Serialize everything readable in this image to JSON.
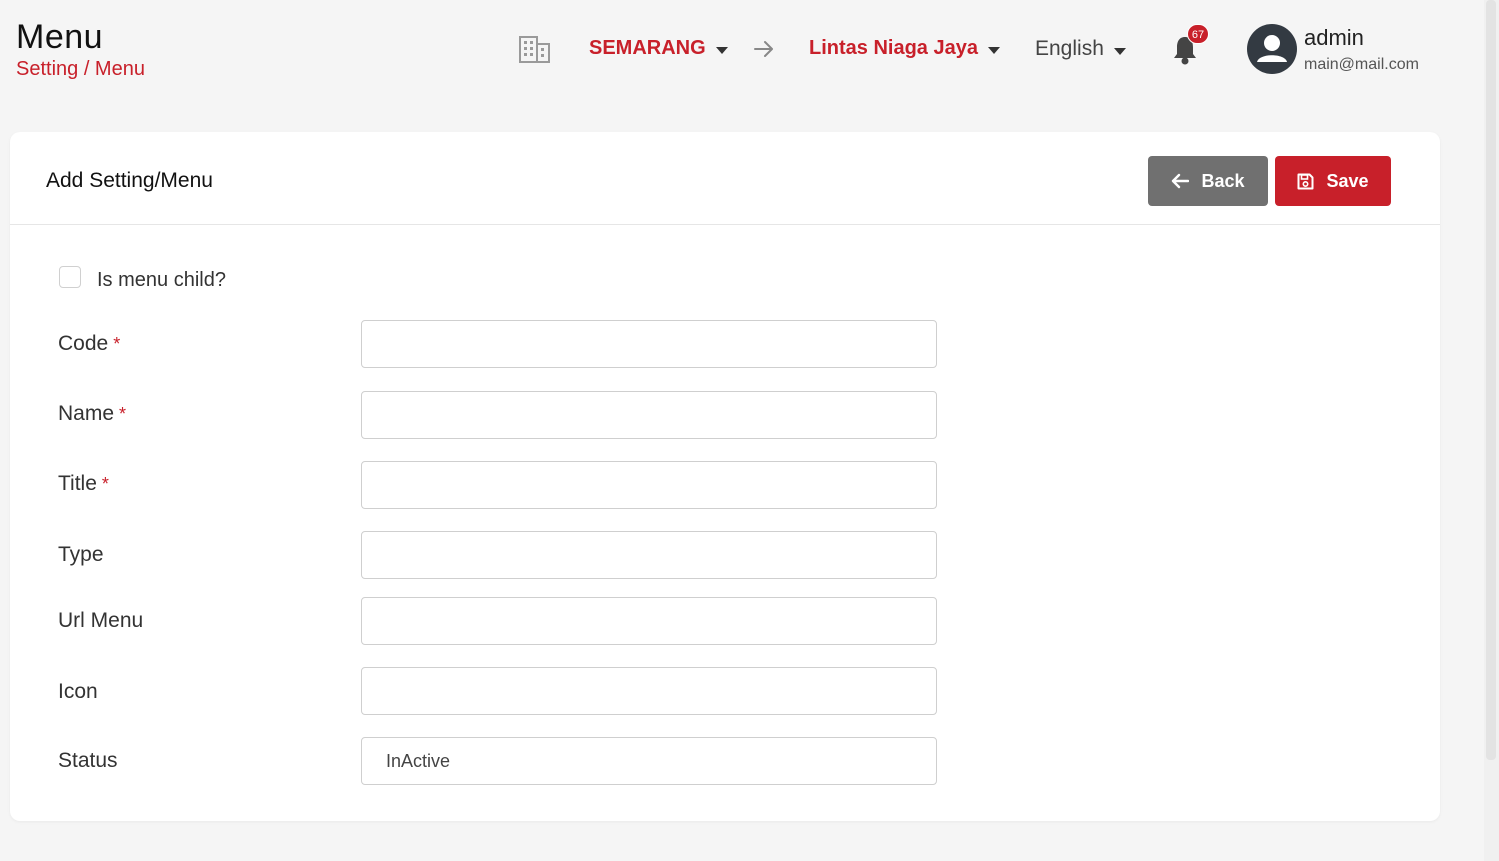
{
  "header": {
    "title": "Menu",
    "breadcrumb": "Setting / Menu",
    "branch": "SEMARANG",
    "company": "Lintas Niaga Jaya",
    "language": "English",
    "notification_count": "67",
    "user": {
      "name": "admin",
      "email": "main@mail.com"
    }
  },
  "card": {
    "title": "Add Setting/Menu",
    "back_label": "Back",
    "save_label": "Save"
  },
  "form": {
    "child_label": "Is menu child?",
    "required_mark": "*",
    "code_label": "Code",
    "name_label": "Name",
    "title_label": "Title",
    "type_label": "Type",
    "url_label": "Url Menu",
    "icon_label": "Icon",
    "status_label": "Status",
    "status_value": "InActive"
  },
  "colors": {
    "accent": "#c8202a",
    "back_button": "#707070"
  },
  "icons": [
    "building-icon",
    "arrow-right-icon",
    "bell-icon",
    "user-avatar-icon",
    "arrow-left-icon",
    "save-icon",
    "caret-down-icon"
  ]
}
